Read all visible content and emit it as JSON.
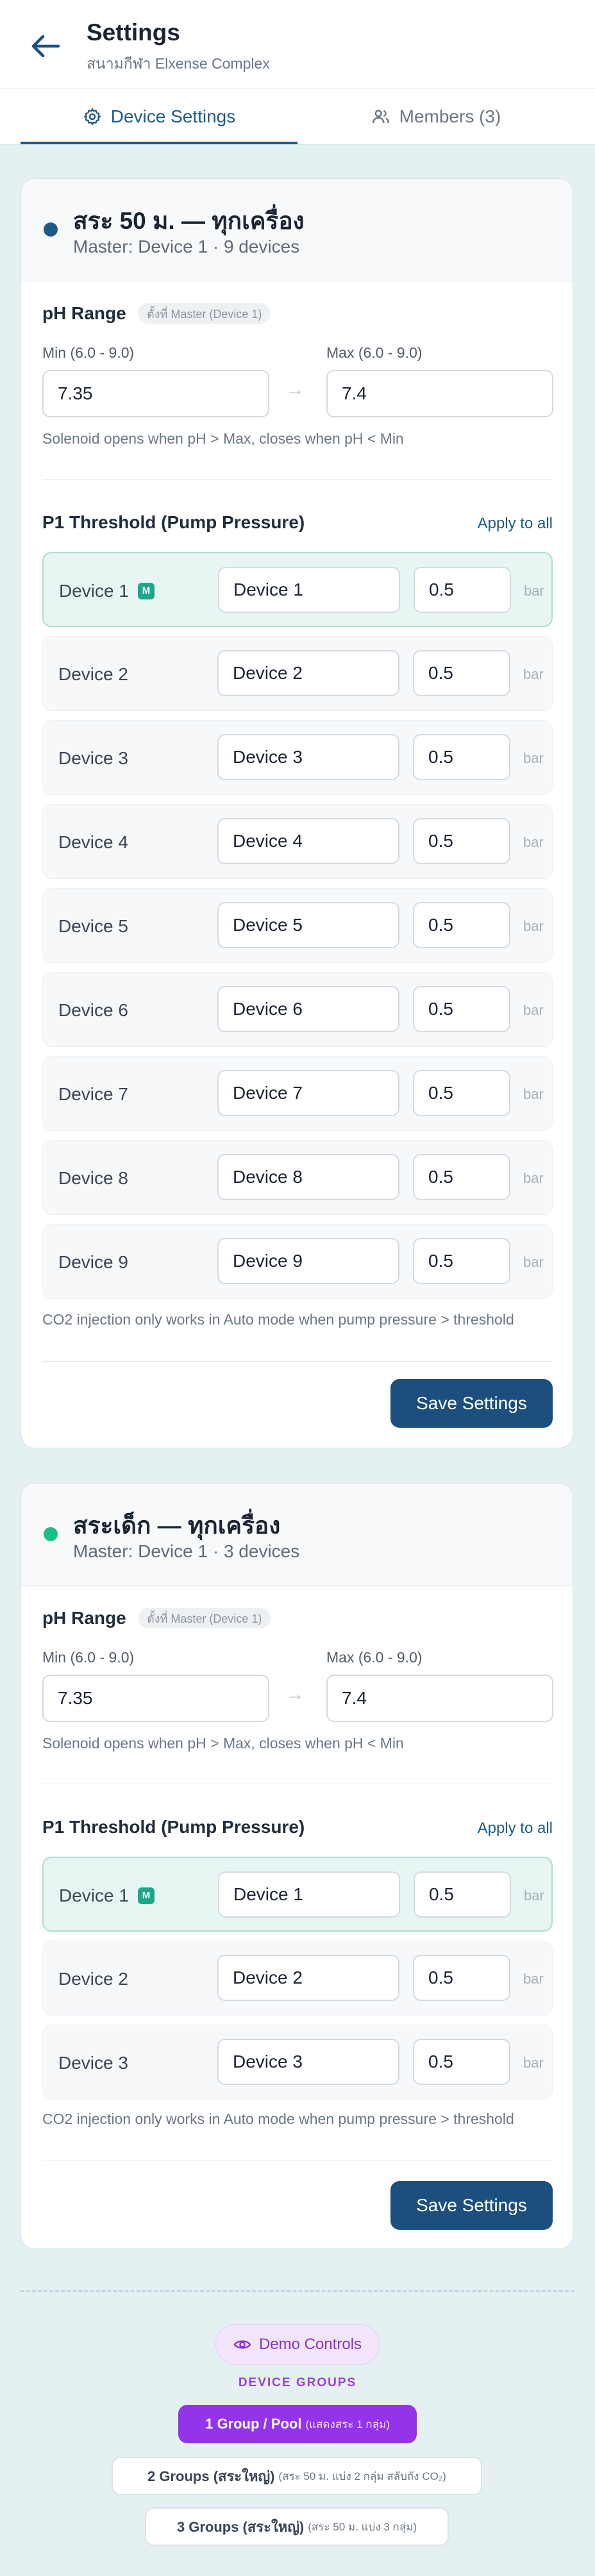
{
  "header": {
    "title": "Settings",
    "subtitle": "สนามกีฬา Elxense Complex"
  },
  "tabs": [
    {
      "label": "Device Settings",
      "icon": "gear-icon",
      "active": true
    },
    {
      "label": "Members (3)",
      "icon": "users-icon",
      "active": false
    }
  ],
  "cards": [
    {
      "title": "สระ 50 ม. — ทุกเครื่อง",
      "subtitle": "Master: Device 1 · 9 devices",
      "dot_color": "#1d5a8a",
      "ph": {
        "label": "pH Range",
        "pill": "ตั้งที่ Master (Device 1)",
        "min_label": "Min (6.0 - 9.0)",
        "min_value": "7.35",
        "max_label": "Max (6.0 - 9.0)",
        "max_value": "7.4",
        "hint": "Solenoid opens when pH > Max, closes when pH < Min"
      },
      "p1": {
        "label": "P1 Threshold (Pump Pressure)",
        "apply_all": "Apply to all",
        "unit": "bar",
        "rows": [
          {
            "name": "Device 1",
            "input": "Device 1",
            "value": "0.5",
            "master": true,
            "badge": "M"
          },
          {
            "name": "Device 2",
            "input": "Device 2",
            "value": "0.5",
            "master": false
          },
          {
            "name": "Device 3",
            "input": "Device 3",
            "value": "0.5",
            "master": false
          },
          {
            "name": "Device 4",
            "input": "Device 4",
            "value": "0.5",
            "master": false
          },
          {
            "name": "Device 5",
            "input": "Device 5",
            "value": "0.5",
            "master": false
          },
          {
            "name": "Device 6",
            "input": "Device 6",
            "value": "0.5",
            "master": false
          },
          {
            "name": "Device 7",
            "input": "Device 7",
            "value": "0.5",
            "master": false
          },
          {
            "name": "Device 8",
            "input": "Device 8",
            "value": "0.5",
            "master": false
          },
          {
            "name": "Device 9",
            "input": "Device 9",
            "value": "0.5",
            "master": false
          }
        ],
        "hint": "CO2 injection only works in Auto mode when pump pressure > threshold"
      },
      "save_label": "Save Settings"
    },
    {
      "title": "สระเด็ก — ทุกเครื่อง",
      "subtitle": "Master: Device 1 · 3 devices",
      "dot_color": "#1bbf85",
      "ph": {
        "label": "pH Range",
        "pill": "ตั้งที่ Master (Device 1)",
        "min_label": "Min (6.0 - 9.0)",
        "min_value": "7.35",
        "max_label": "Max (6.0 - 9.0)",
        "max_value": "7.4",
        "hint": "Solenoid opens when pH > Max, closes when pH < Min"
      },
      "p1": {
        "label": "P1 Threshold (Pump Pressure)",
        "apply_all": "Apply to all",
        "unit": "bar",
        "rows": [
          {
            "name": "Device 1",
            "input": "Device 1",
            "value": "0.5",
            "master": true,
            "badge": "M"
          },
          {
            "name": "Device 2",
            "input": "Device 2",
            "value": "0.5",
            "master": false
          },
          {
            "name": "Device 3",
            "input": "Device 3",
            "value": "0.5",
            "master": false
          }
        ],
        "hint": "CO2 injection only works in Auto mode when pump pressure > threshold"
      },
      "save_label": "Save Settings"
    }
  ],
  "demo": {
    "pill_label": "Demo Controls",
    "heading": "DEVICE GROUPS",
    "groups": [
      {
        "label": "1 Group / Pool",
        "note": "(แสดงสระ 1 กลุ่ม)",
        "active": true
      },
      {
        "label": "2 Groups (สระใหญ่)",
        "note": "(สระ 50 ม. แบ่ง 2 กลุ่ม สลับถัง CO₂)",
        "active": false
      },
      {
        "label": "3 Groups (สระใหญ่)",
        "note": "(สระ 50 ม. แบ่ง 3 กลุ่ม)",
        "active": false
      }
    ]
  },
  "colors": {
    "accent": "#1d5a8a",
    "save_button": "#1d4f7e",
    "master_row_bg": "#e8f6f3",
    "demo_purple": "#9333ea"
  }
}
